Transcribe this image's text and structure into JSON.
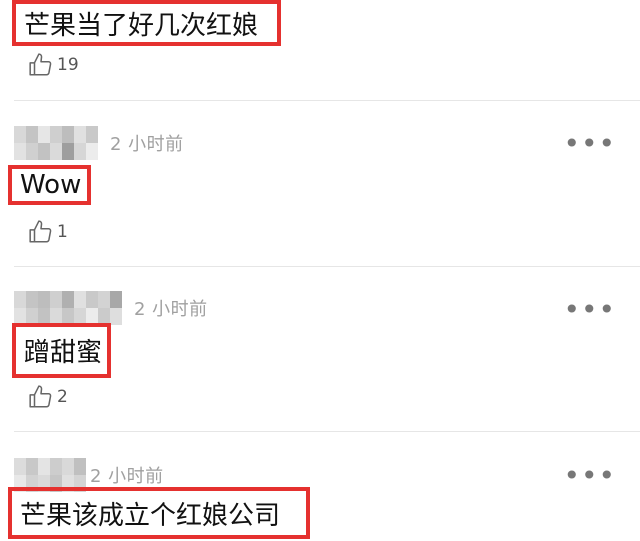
{
  "comments": [
    {
      "text": "芒果当了好几次红娘",
      "likes": "19"
    },
    {
      "time": "2 小时前",
      "text": "Wow",
      "likes": "1"
    },
    {
      "time": "2 小时前",
      "text": "蹭甜蜜",
      "likes": "2"
    },
    {
      "time": "2 小时前",
      "text": "芒果该成立个红娘公司"
    }
  ],
  "more_glyph": "•••",
  "colors": {
    "highlight": "#e5312f",
    "meta": "#a0a0a0",
    "divider": "#e6e6e6"
  }
}
